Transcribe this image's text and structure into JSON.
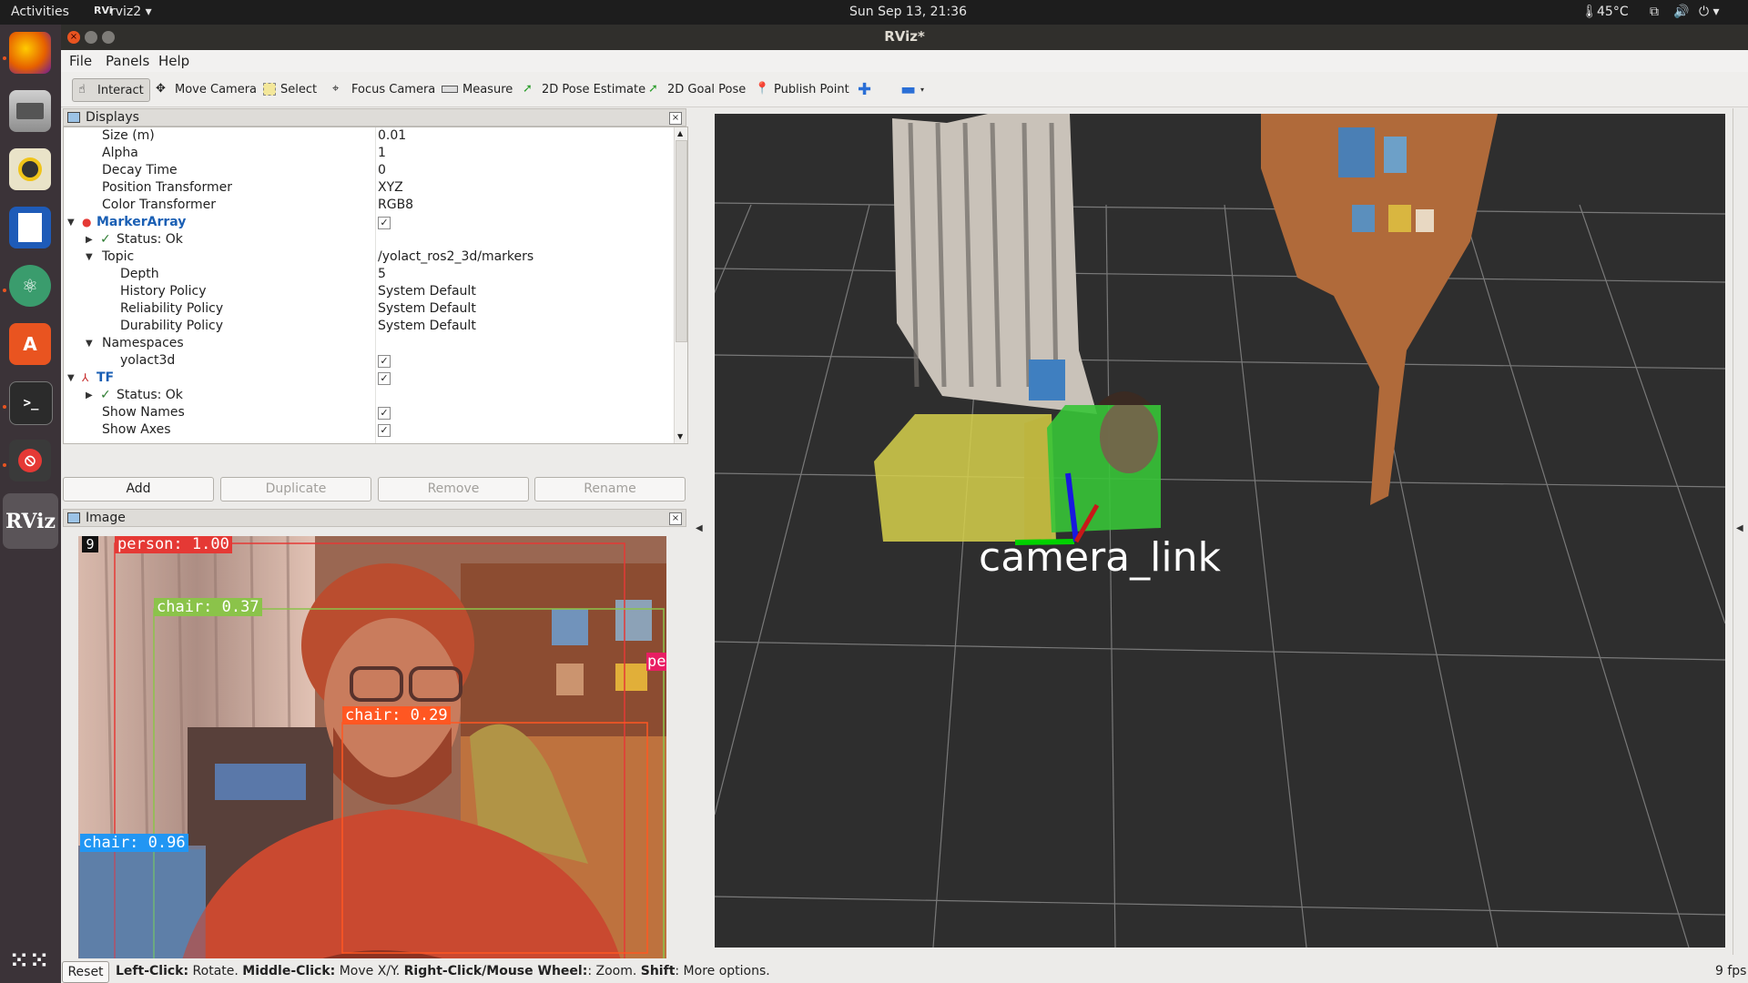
{
  "topbar": {
    "activities": "Activities",
    "app": "rviz2",
    "app_icon": "rviz-small-icon",
    "clock": "Sun Sep 13, 21:36",
    "temperature": "45°C"
  },
  "dock": {
    "items": [
      "firefox",
      "files",
      "rhythmbox",
      "libreoffice-writer",
      "atom",
      "ubuntu-software",
      "terminal",
      "stop-app",
      "rviz"
    ],
    "rviz_label": "RViz"
  },
  "window": {
    "title": "RViz*",
    "menu": [
      "File",
      "Panels",
      "Help"
    ]
  },
  "toolbar": {
    "tools": [
      "Interact",
      "Move Camera",
      "Select",
      "Focus Camera",
      "Measure",
      "2D Pose Estimate",
      "2D Goal Pose",
      "Publish Point"
    ],
    "active": "Interact"
  },
  "displays": {
    "title": "Displays",
    "rows": [
      {
        "label": "Size (m)",
        "value": "0.01"
      },
      {
        "label": "Alpha",
        "value": "1"
      },
      {
        "label": "Decay Time",
        "value": "0"
      },
      {
        "label": "Position Transformer",
        "value": "XYZ"
      },
      {
        "label": "Color Transformer",
        "value": "RGB8"
      },
      {
        "label": "MarkerArray",
        "value": ""
      },
      {
        "label": "Status: Ok",
        "value": ""
      },
      {
        "label": "Topic",
        "value": "/yolact_ros2_3d/markers"
      },
      {
        "label": "Depth",
        "value": "5"
      },
      {
        "label": "History Policy",
        "value": "System Default"
      },
      {
        "label": "Reliability Policy",
        "value": "System Default"
      },
      {
        "label": "Durability Policy",
        "value": "System Default"
      },
      {
        "label": "Namespaces",
        "value": ""
      },
      {
        "label": "yolact3d",
        "value": ""
      },
      {
        "label": "TF",
        "value": ""
      },
      {
        "label": "Status: Ok",
        "value": ""
      },
      {
        "label": "Show Names",
        "value": ""
      },
      {
        "label": "Show Axes",
        "value": ""
      }
    ],
    "buttons": {
      "add": "Add",
      "duplicate": "Duplicate",
      "remove": "Remove",
      "rename": "Rename"
    }
  },
  "image_panel": {
    "title": "Image",
    "frame_number": "9",
    "detections": [
      {
        "label": "person: 1.00",
        "color": "#e53935"
      },
      {
        "label": "chair: 0.37",
        "color": "#8bc34a"
      },
      {
        "label": "chair: 0.29",
        "color": "#ff5722"
      },
      {
        "label": "chair: 0.96",
        "color": "#2196f3"
      },
      {
        "label": "pe",
        "color": "#e91e63"
      }
    ]
  },
  "viewport": {
    "frame_label": "camera_link"
  },
  "statusbar": {
    "reset": "Reset",
    "k1": "Left-Click:",
    "v1": " Rotate. ",
    "k2": "Middle-Click:",
    "v2": " Move X/Y. ",
    "k3": "Right-Click/Mouse Wheel:",
    "v3": ": Zoom. ",
    "k4": "Shift",
    "v4": ": More options.",
    "fps": "9 fps"
  }
}
